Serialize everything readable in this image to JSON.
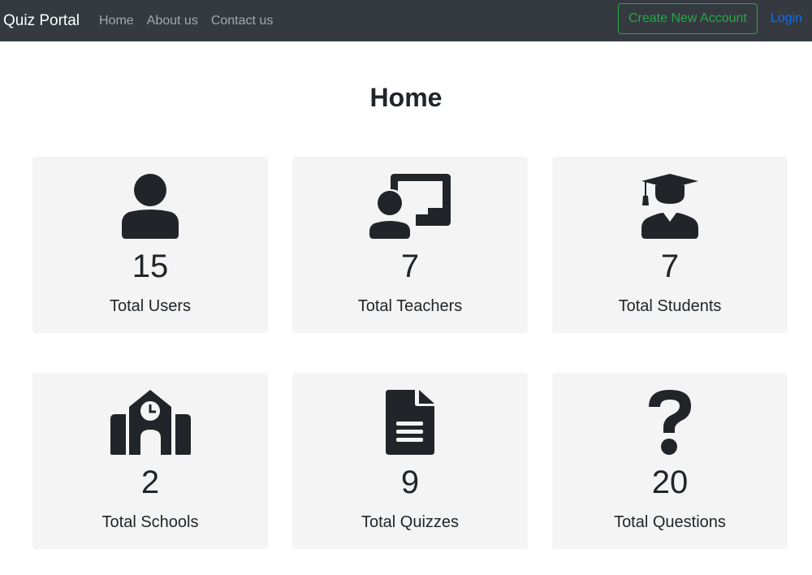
{
  "navbar": {
    "brand": "Quiz Portal",
    "links": [
      "Home",
      "About us",
      "Contact us"
    ],
    "create_account_label": "Create New Account",
    "login_label": "Login"
  },
  "page": {
    "title": "Home"
  },
  "stats": [
    {
      "icon": "user-icon",
      "count": "15",
      "label": "Total Users"
    },
    {
      "icon": "teacher-icon",
      "count": "7",
      "label": "Total Teachers"
    },
    {
      "icon": "graduate-icon",
      "count": "7",
      "label": "Total Students"
    },
    {
      "icon": "school-icon",
      "count": "2",
      "label": "Total Schools"
    },
    {
      "icon": "document-icon",
      "count": "9",
      "label": "Total Quizzes"
    },
    {
      "icon": "question-icon",
      "count": "20",
      "label": "Total Questions"
    }
  ],
  "colors": {
    "navbar_bg": "#343a40",
    "card_bg": "#f4f4f4",
    "success": "#28a745",
    "link_blue": "#0d6efd",
    "icon": "#212529"
  }
}
